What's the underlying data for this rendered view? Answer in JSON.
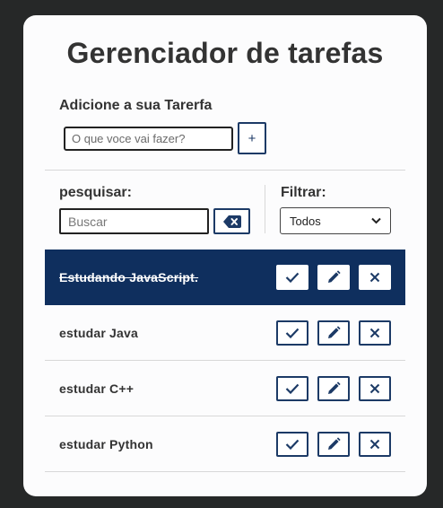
{
  "title": "Gerenciador de tarefas",
  "add": {
    "heading": "Adicione a sua Tarerfa",
    "placeholder": "O que voce vai fazer?",
    "button_label": "+"
  },
  "search": {
    "heading": "pesquisar:",
    "placeholder": "Buscar",
    "clear_icon": "backspace-icon"
  },
  "filter": {
    "heading": "Filtrar:",
    "selected": "Todos"
  },
  "todos": [
    {
      "text": "Estudando JavaScript.",
      "done": true
    },
    {
      "text": "estudar Java",
      "done": false
    },
    {
      "text": "estudar C++",
      "done": false
    },
    {
      "text": "estudar Python",
      "done": false
    }
  ],
  "colors": {
    "background": "#262828",
    "card": "#fcfcfd",
    "accent": "#1c3a66",
    "done_row": "#0f2f5e"
  },
  "icons": {
    "finish": "check-icon",
    "edit": "pencil-icon",
    "remove": "close-icon"
  }
}
